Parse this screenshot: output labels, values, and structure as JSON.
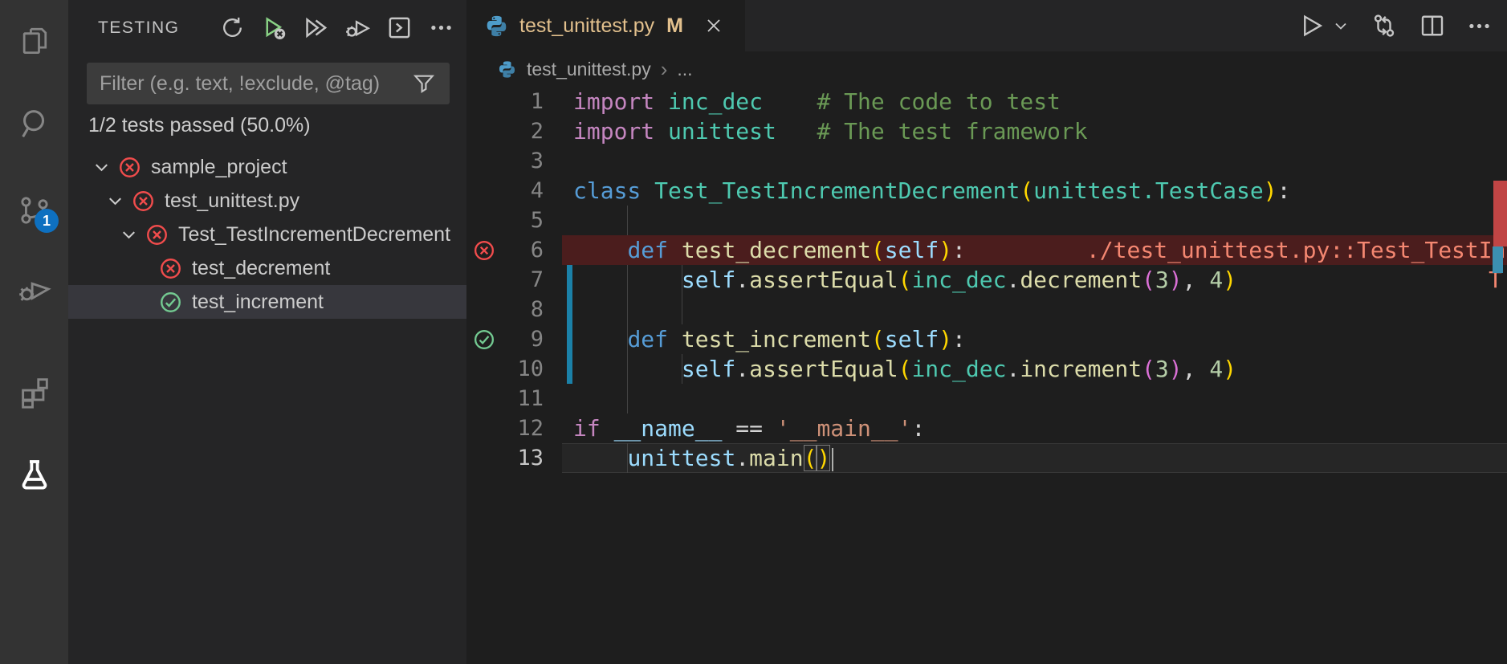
{
  "colors": {
    "fail_red": "#f14c4c",
    "pass_green": "#73c991",
    "run_green": "#89d185",
    "badge_blue": "#0e70c0",
    "modified_gold": "#e2c08d",
    "git_gutter_blue": "#1b81a8",
    "error_line_bg": "#4b1d1d",
    "selection_row": "#37373d",
    "sidebar_bg": "#252526",
    "editor_bg": "#1e1e1e",
    "activitybar_bg": "#333333"
  },
  "activity_bar": {
    "source_control_badge": "1"
  },
  "sidebar": {
    "title": "TESTING",
    "toolbar": {
      "refresh": "refresh-tests",
      "run_failed": "rerun-failed-tests",
      "run_all": "run-all-tests",
      "debug": "debug-tests",
      "output": "show-test-output",
      "more": "more-actions"
    },
    "filter_placeholder": "Filter (e.g. text, !exclude, @tag)",
    "summary": "1/2 tests passed (50.0%)",
    "tree": [
      {
        "label": "sample_project",
        "state": "failed",
        "level": 0,
        "chevron": true,
        "selected": false
      },
      {
        "label": "test_unittest.py",
        "state": "failed",
        "level": 1,
        "chevron": true,
        "selected": false
      },
      {
        "label": "Test_TestIncrementDecrement",
        "state": "failed",
        "level": 2,
        "chevron": true,
        "selected": false
      },
      {
        "label": "test_decrement",
        "state": "failed",
        "level": 3,
        "chevron": false,
        "selected": false
      },
      {
        "label": "test_increment",
        "state": "passed",
        "level": 3,
        "chevron": false,
        "selected": true
      }
    ]
  },
  "tab": {
    "title": "test_unittest.py",
    "git_badge": "M"
  },
  "breadcrumb": {
    "file": "test_unittest.py",
    "separator": "›",
    "more": "..."
  },
  "editor": {
    "token_colors": {
      "kw": "#C586C0",
      "def": "#569CD6",
      "type": "#4EC9B0",
      "fn": "#DCDCAA",
      "var": "#9CDCFE",
      "num": "#B5CEA8",
      "str": "#CE9178",
      "cm": "#6A9955",
      "p": "#D4D4D4",
      "b1": "#FFD700",
      "b2": "#DA70D6",
      "bm": "#FFD700",
      "err": "#F48771"
    },
    "lines": [
      {
        "n": 1,
        "tokens": [
          {
            "c": "kw",
            "t": "import"
          },
          {
            "c": "p",
            "t": " "
          },
          {
            "c": "type",
            "t": "inc_dec"
          },
          {
            "c": "p",
            "t": "    "
          },
          {
            "c": "cm",
            "t": "# The code to test"
          }
        ]
      },
      {
        "n": 2,
        "tokens": [
          {
            "c": "kw",
            "t": "import"
          },
          {
            "c": "p",
            "t": " "
          },
          {
            "c": "type",
            "t": "unittest"
          },
          {
            "c": "p",
            "t": "   "
          },
          {
            "c": "cm",
            "t": "# The test framework"
          }
        ]
      },
      {
        "n": 3,
        "tokens": []
      },
      {
        "n": 4,
        "tokens": [
          {
            "c": "def",
            "t": "class"
          },
          {
            "c": "p",
            "t": " "
          },
          {
            "c": "type",
            "t": "Test_TestIncrementDecrement"
          },
          {
            "c": "b1",
            "t": "("
          },
          {
            "c": "type",
            "t": "unittest.TestCase"
          },
          {
            "c": "b1",
            "t": ")"
          },
          {
            "c": "p",
            "t": ":"
          }
        ]
      },
      {
        "n": 5,
        "tokens": [],
        "guides": [
          4
        ]
      },
      {
        "n": 6,
        "tokens": [
          {
            "c": "p",
            "t": "    "
          },
          {
            "c": "def",
            "t": "def"
          },
          {
            "c": "p",
            "t": " "
          },
          {
            "c": "fn",
            "t": "test_decrement"
          },
          {
            "c": "b1",
            "t": "("
          },
          {
            "c": "var",
            "t": "self"
          },
          {
            "c": "b1",
            "t": ")"
          },
          {
            "c": "p",
            "t": ":"
          }
        ],
        "error_row": true,
        "gutter": "failed",
        "message": "./test_unittest.py::Test_TestIncrementDecrement"
      },
      {
        "n": 7,
        "tokens": [
          {
            "c": "p",
            "t": "        "
          },
          {
            "c": "var",
            "t": "self"
          },
          {
            "c": "p",
            "t": "."
          },
          {
            "c": "fn",
            "t": "assertEqual"
          },
          {
            "c": "b1",
            "t": "("
          },
          {
            "c": "type",
            "t": "inc_dec"
          },
          {
            "c": "p",
            "t": "."
          },
          {
            "c": "fn",
            "t": "decrement"
          },
          {
            "c": "b2",
            "t": "("
          },
          {
            "c": "num",
            "t": "3"
          },
          {
            "c": "b2",
            "t": ")"
          },
          {
            "c": "p",
            "t": ", "
          },
          {
            "c": "num",
            "t": "4"
          },
          {
            "c": "b1",
            "t": ")"
          }
        ],
        "modified": true,
        "guides": [
          4,
          8
        ],
        "message_right": "T"
      },
      {
        "n": 8,
        "tokens": [],
        "modified": true,
        "guides": [
          4,
          8
        ]
      },
      {
        "n": 9,
        "tokens": [
          {
            "c": "p",
            "t": "    "
          },
          {
            "c": "def",
            "t": "def"
          },
          {
            "c": "p",
            "t": " "
          },
          {
            "c": "fn",
            "t": "test_increment"
          },
          {
            "c": "b1",
            "t": "("
          },
          {
            "c": "var",
            "t": "self"
          },
          {
            "c": "b1",
            "t": ")"
          },
          {
            "c": "p",
            "t": ":"
          }
        ],
        "modified": true,
        "gutter": "passed",
        "guides": [
          4
        ]
      },
      {
        "n": 10,
        "tokens": [
          {
            "c": "p",
            "t": "        "
          },
          {
            "c": "var",
            "t": "self"
          },
          {
            "c": "p",
            "t": "."
          },
          {
            "c": "fn",
            "t": "assertEqual"
          },
          {
            "c": "b1",
            "t": "("
          },
          {
            "c": "type",
            "t": "inc_dec"
          },
          {
            "c": "p",
            "t": "."
          },
          {
            "c": "fn",
            "t": "increment"
          },
          {
            "c": "b2",
            "t": "("
          },
          {
            "c": "num",
            "t": "3"
          },
          {
            "c": "b2",
            "t": ")"
          },
          {
            "c": "p",
            "t": ", "
          },
          {
            "c": "num",
            "t": "4"
          },
          {
            "c": "b1",
            "t": ")"
          }
        ],
        "modified": true,
        "guides": [
          4,
          8
        ]
      },
      {
        "n": 11,
        "tokens": [],
        "guides": [
          4
        ]
      },
      {
        "n": 12,
        "tokens": [
          {
            "c": "kw",
            "t": "if"
          },
          {
            "c": "p",
            "t": " "
          },
          {
            "c": "var",
            "t": "__name__"
          },
          {
            "c": "p",
            "t": " == "
          },
          {
            "c": "str",
            "t": "'__main__'"
          },
          {
            "c": "p",
            "t": ":"
          }
        ]
      },
      {
        "n": 13,
        "tokens": [
          {
            "c": "p",
            "t": "    "
          },
          {
            "c": "var",
            "t": "unittest"
          },
          {
            "c": "p",
            "t": "."
          },
          {
            "c": "fn",
            "t": "main"
          },
          {
            "c": "bm",
            "t": "("
          },
          {
            "c": "bm",
            "t": ")"
          }
        ],
        "current": true,
        "cursor": true,
        "guides": [
          4
        ]
      }
    ]
  }
}
